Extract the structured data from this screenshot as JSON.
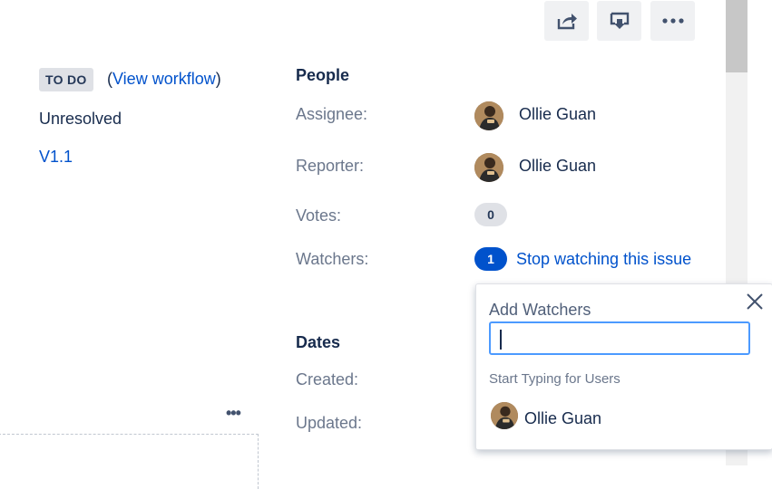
{
  "toolbar": {
    "share_icon": "share-icon",
    "export_icon": "export-icon",
    "more_icon": "more-icon"
  },
  "status": {
    "lozenge": "TO DO",
    "workflow_open": "(",
    "workflow_link": "View workflow",
    "workflow_close": ")",
    "resolution": "Unresolved",
    "fix_version": "V1.1"
  },
  "people": {
    "heading": "People",
    "assignee_label": "Assignee:",
    "assignee_name": "Ollie Guan",
    "reporter_label": "Reporter:",
    "reporter_name": "Ollie Guan",
    "votes_label": "Votes:",
    "votes_count": "0",
    "watchers_label": "Watchers:",
    "watchers_count": "1",
    "watch_link": "Stop watching this issue"
  },
  "dates": {
    "heading": "Dates",
    "created_label": "Created:",
    "updated_label": "Updated:"
  },
  "left_more": "•••",
  "popup": {
    "title": "Add Watchers",
    "input_value": "",
    "hint": "Start Typing for Users",
    "suggestion_name": "Ollie Guan"
  },
  "colors": {
    "link": "#0052cc",
    "badge_blue": "#0052cc",
    "lozenge_bg": "#dfe1e6",
    "focus": "#4c9aff"
  }
}
